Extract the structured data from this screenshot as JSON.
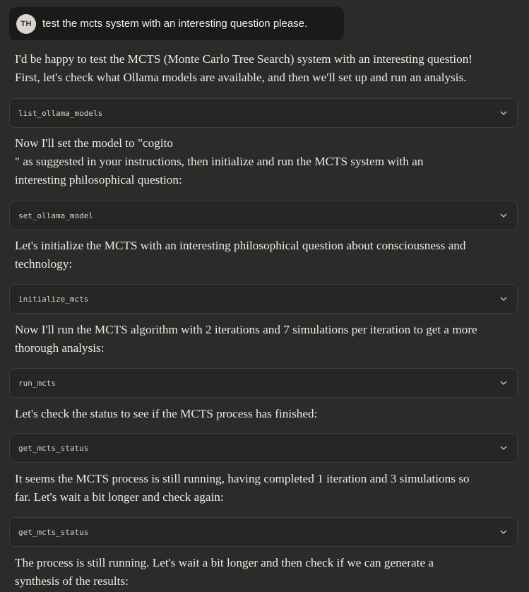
{
  "user_message": {
    "avatar_initials": "TH",
    "text": "test the mcts system with an interesting question please."
  },
  "messages": [
    {
      "lines": [
        "I'd be happy to test the MCTS (Monte Carlo Tree Search) system with an interesting question!",
        "First, let's check what Ollama models are available, and then we'll set up and run an analysis."
      ]
    },
    {
      "tool": "list_ollama_models"
    },
    {
      "lines": [
        "Now I'll set the model to \"cogito",
        "\" as suggested in your instructions, then initialize and run the MCTS system with an",
        "interesting philosophical question:"
      ]
    },
    {
      "tool": "set_ollama_model"
    },
    {
      "lines": [
        "Let's initialize the MCTS with an interesting philosophical question about consciousness and",
        "technology:"
      ]
    },
    {
      "tool": "initialize_mcts"
    },
    {
      "lines": [
        "Now I'll run the MCTS algorithm with 2 iterations and 7 simulations per iteration to get a more",
        "thorough analysis:"
      ]
    },
    {
      "tool": "run_mcts"
    },
    {
      "lines": [
        "Let's check the status to see if the MCTS process has finished:"
      ]
    },
    {
      "tool": "get_mcts_status"
    },
    {
      "lines": [
        "It seems the MCTS process is still running, having completed 1 iteration and 3 simulations so",
        "far. Let's wait a bit longer and check again:"
      ]
    },
    {
      "tool": "get_mcts_status"
    },
    {
      "lines": [
        "The process is still running. Let's wait a bit longer and then check if we can generate a",
        "synthesis of the results:"
      ]
    }
  ],
  "icons": {
    "tool_expand": "chevron-down-icon"
  },
  "colors": {
    "background": "#2b2b29",
    "user_bubble": "#1a1a18",
    "tool_card": "#262624",
    "tool_border": "#3d3d3a",
    "text": "#ecebe6"
  }
}
